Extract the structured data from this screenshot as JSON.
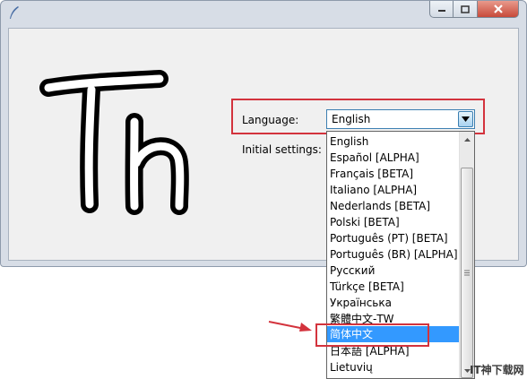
{
  "window": {
    "controls": {
      "minimize_icon": "minimize-icon",
      "maximize_icon": "maximize-icon",
      "close_icon": "close-icon"
    }
  },
  "form": {
    "language_label": "Language:",
    "initial_settings_label": "Initial settings:"
  },
  "language_select": {
    "value": "English",
    "options": [
      "English",
      "Español [ALPHA]",
      "Français [BETA]",
      "Italiano [ALPHA]",
      "Nederlands [BETA]",
      "Polski [BETA]",
      "Português (PT) [BETA]",
      "Português (BR) [ALPHA]",
      "Русский",
      "Türkçe [BETA]",
      "Українська",
      "繁體中文-TW",
      "简体中文",
      "日本語 [ALPHA]",
      "Lietuvių"
    ],
    "highlighted_option": "简体中文"
  },
  "watermark": "IT神下载网",
  "colors": {
    "annotation_red": "#d3333d",
    "selection_blue": "#3399ff"
  }
}
